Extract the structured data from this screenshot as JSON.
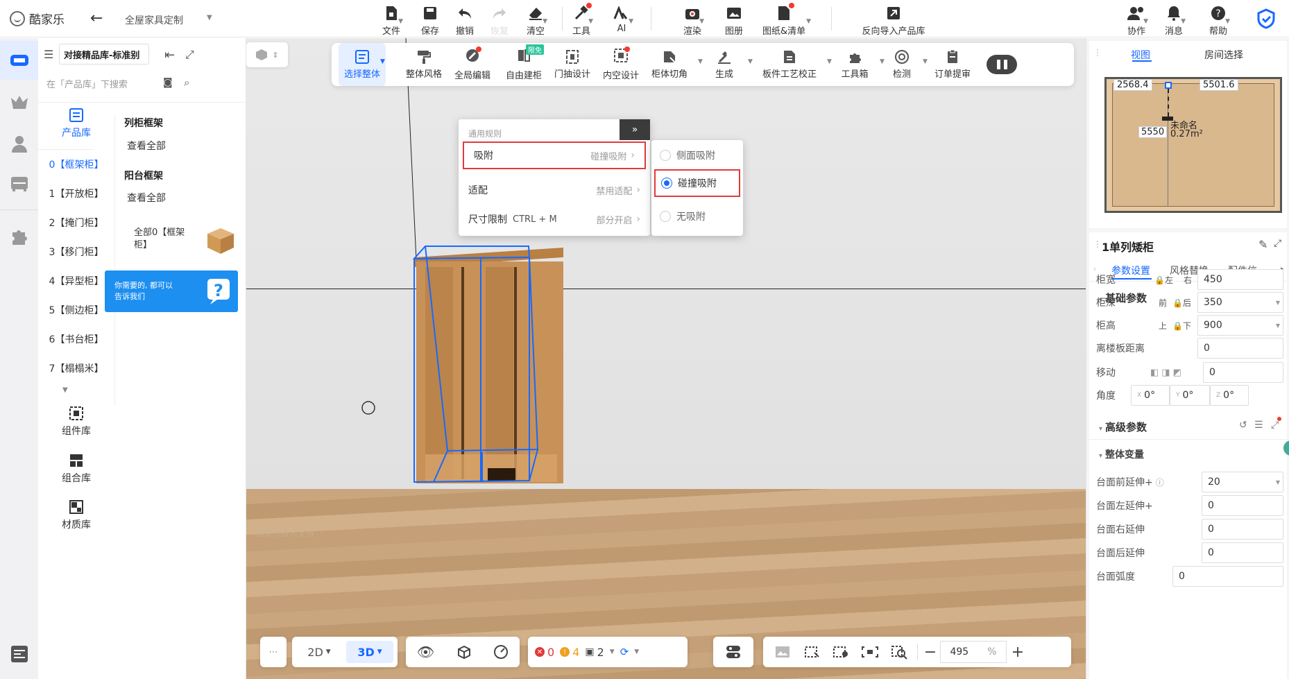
{
  "app": {
    "logo_text": "酷家乐",
    "project_title": "全屋家具定制"
  },
  "top_toolbar": [
    {
      "label": "文件",
      "icon": "file-icon"
    },
    {
      "label": "保存",
      "icon": "save-icon"
    },
    {
      "label": "撤销",
      "icon": "undo-icon"
    },
    {
      "label": "恢复",
      "icon": "redo-icon"
    },
    {
      "label": "清空",
      "icon": "eraser-icon"
    },
    {
      "label": "工具",
      "icon": "hammer-icon"
    },
    {
      "label": "AI",
      "icon": "ai-icon"
    },
    {
      "label": "渲染",
      "icon": "camera-icon"
    },
    {
      "label": "图册",
      "icon": "album-icon"
    },
    {
      "label": "图纸&清单",
      "icon": "drawing-icon"
    },
    {
      "label": "反向导入产品库",
      "icon": "import-icon"
    }
  ],
  "top_right": [
    {
      "label": "协作",
      "icon": "users-icon"
    },
    {
      "label": "消息",
      "icon": "bell-icon"
    },
    {
      "label": "帮助",
      "icon": "help-icon"
    }
  ],
  "library": {
    "dropdown": "对接精品库-标准别",
    "search_placeholder": "在「产品库」下搜索",
    "tab_label": "产品库",
    "categories": [
      "0【框架柜】",
      "1【开放柜】",
      "2【掩门柜】",
      "3【移门柜】",
      "4【异型柜】",
      "5【侧边柜】",
      "6【书台柜】",
      "7【榻榻米】"
    ],
    "bottom_items": [
      "组件库",
      "组合库",
      "材质库"
    ],
    "groups": [
      {
        "title": "列柜框架",
        "link": "查看全部"
      },
      {
        "title": "阳台框架",
        "link": "查看全部"
      }
    ],
    "card_label": "全部0【框架柜】",
    "banner_text": "你需要的, 都可以告诉我们"
  },
  "tool2": [
    {
      "label": "选择整体",
      "icon": "select-all-icon",
      "active": true
    },
    {
      "label": "整体风格",
      "icon": "paint-roller-icon"
    },
    {
      "label": "全局编辑",
      "icon": "global-edit-icon"
    },
    {
      "label": "自由建柜",
      "icon": "free-build-icon",
      "badge": "限免"
    },
    {
      "label": "门抽设计",
      "icon": "door-drawer-icon"
    },
    {
      "label": "内空设计",
      "icon": "inner-space-icon"
    },
    {
      "label": "柜体切角",
      "icon": "corner-cut-icon"
    },
    {
      "label": "生成",
      "icon": "generate-icon"
    },
    {
      "label": "板件工艺校正",
      "icon": "panel-process-icon"
    },
    {
      "label": "工具箱",
      "icon": "toolbox-icon"
    },
    {
      "label": "检测",
      "icon": "detect-icon"
    },
    {
      "label": "订单提审",
      "icon": "order-icon"
    }
  ],
  "popup": {
    "header": "通用规则",
    "rows": [
      {
        "label": "吸附",
        "value": "碰撞吸附"
      },
      {
        "label": "适配",
        "value": "禁用适配"
      },
      {
        "label": "尺寸限制",
        "shortcut": "CTRL + M",
        "value": "部分开启"
      }
    ],
    "sub_options": [
      {
        "label": "侧面吸附",
        "checked": false
      },
      {
        "label": "碰撞吸附",
        "checked": true
      },
      {
        "label": "无吸附",
        "checked": false
      }
    ]
  },
  "bottom_bar": {
    "view_2d": "2D",
    "view_3d": "3D",
    "errors": "0",
    "warnings": "4",
    "info": "2",
    "zoom": "495",
    "zoom_unit": "%"
  },
  "watermark": "酷家乐技术支持",
  "minimap": {
    "tab_view": "视图",
    "tab_room": "房间选择",
    "dim_left": "2568.4",
    "dim_right": "5501.6",
    "dim_height": "5550",
    "room_name": "未命名",
    "room_area": "0.27m²"
  },
  "props": {
    "title": "1单列矮柜",
    "tabs": [
      "参数设置",
      "风格替换",
      "配件信"
    ],
    "basic_title": "基础参数",
    "rows": [
      {
        "label": "柜宽",
        "a": "左",
        "b": "右",
        "value": "450"
      },
      {
        "label": "柜深",
        "a": "前",
        "b": "后",
        "value": "350"
      },
      {
        "label": "柜高",
        "a": "上",
        "b": "下",
        "value": "900"
      }
    ],
    "floor_gap_label": "离楼板距离",
    "floor_gap": "0",
    "move_label": "移动",
    "move": "0",
    "angle_label": "角度",
    "angle_x": "0°",
    "angle_y": "0°",
    "angle_z": "0°",
    "advanced_title": "高级参数",
    "overall_title": "整体变量",
    "adv_rows": [
      {
        "label": "台面前延伸+",
        "value": "20"
      },
      {
        "label": "台面左延伸+",
        "value": "0"
      },
      {
        "label": "台面右延伸",
        "value": "0"
      },
      {
        "label": "台面后延伸",
        "value": "0"
      },
      {
        "label": "台面弧度",
        "value": "0"
      }
    ]
  },
  "colors": {
    "accent": "#1769ff",
    "highlight": "#e23a3a",
    "wood": "#c89158"
  }
}
